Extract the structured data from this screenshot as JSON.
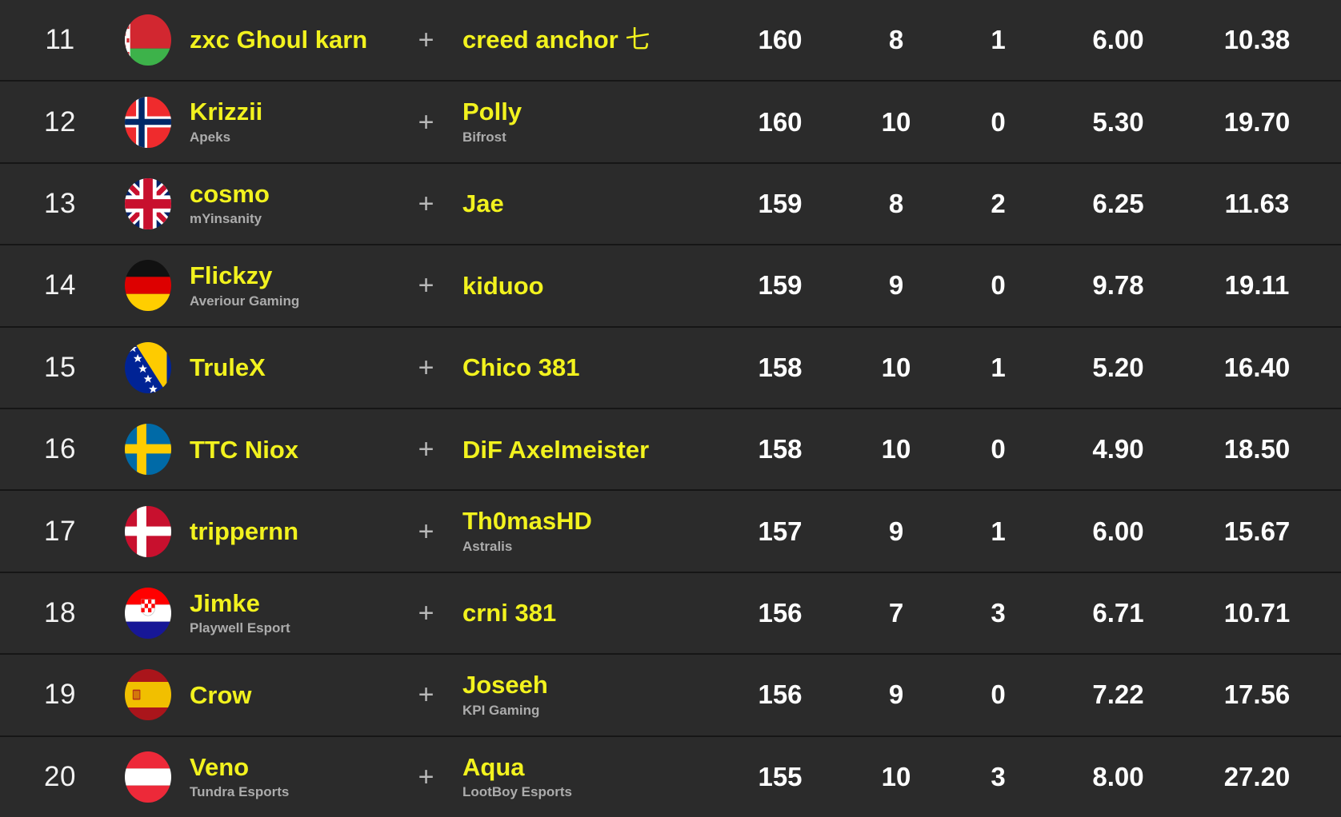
{
  "leaderboard": {
    "separator_symbol": "+",
    "colors": {
      "row_background": "#2b2b2b",
      "page_background": "#1c1c1c",
      "player_name": "#f2f21e",
      "team_name": "#acacac",
      "stat_value": "#ffffff",
      "rank": "#f2f2f2",
      "divider": "#161616"
    },
    "rows": [
      {
        "rank": "11",
        "flag": "belarus-flag",
        "player1": {
          "name": "zxc Ghoul karn",
          "team": ""
        },
        "player2": {
          "name": "creed anchor 七",
          "team": ""
        },
        "score": "160",
        "maps": "8",
        "extra": "1",
        "avg": "6.00",
        "last": "10.38"
      },
      {
        "rank": "12",
        "flag": "norway-flag",
        "player1": {
          "name": "Krizzii",
          "team": "Apeks"
        },
        "player2": {
          "name": "Polly",
          "team": "Bifrost"
        },
        "score": "160",
        "maps": "10",
        "extra": "0",
        "avg": "5.30",
        "last": "19.70"
      },
      {
        "rank": "13",
        "flag": "united-kingdom-flag",
        "player1": {
          "name": "cosmo",
          "team": "mYinsanity"
        },
        "player2": {
          "name": "Jae",
          "team": ""
        },
        "score": "159",
        "maps": "8",
        "extra": "2",
        "avg": "6.25",
        "last": "11.63"
      },
      {
        "rank": "14",
        "flag": "germany-flag",
        "player1": {
          "name": "Flickzy",
          "team": "Averiour Gaming"
        },
        "player2": {
          "name": "kiduoo",
          "team": ""
        },
        "score": "159",
        "maps": "9",
        "extra": "0",
        "avg": "9.78",
        "last": "19.11"
      },
      {
        "rank": "15",
        "flag": "bosnia-herzegovina-flag",
        "player1": {
          "name": "TruleX",
          "team": ""
        },
        "player2": {
          "name": "Chico 381",
          "team": ""
        },
        "score": "158",
        "maps": "10",
        "extra": "1",
        "avg": "5.20",
        "last": "16.40"
      },
      {
        "rank": "16",
        "flag": "sweden-flag",
        "player1": {
          "name": "TTC Niox",
          "team": ""
        },
        "player2": {
          "name": "DiF Axelmeister",
          "team": ""
        },
        "score": "158",
        "maps": "10",
        "extra": "0",
        "avg": "4.90",
        "last": "18.50"
      },
      {
        "rank": "17",
        "flag": "denmark-flag",
        "player1": {
          "name": "trippernn",
          "team": ""
        },
        "player2": {
          "name": "Th0masHD",
          "team": "Astralis"
        },
        "score": "157",
        "maps": "9",
        "extra": "1",
        "avg": "6.00",
        "last": "15.67"
      },
      {
        "rank": "18",
        "flag": "croatia-flag",
        "player1": {
          "name": "Jimke",
          "team": "Playwell Esport"
        },
        "player2": {
          "name": "crni 381",
          "team": ""
        },
        "score": "156",
        "maps": "7",
        "extra": "3",
        "avg": "6.71",
        "last": "10.71"
      },
      {
        "rank": "19",
        "flag": "spain-flag",
        "player1": {
          "name": "Crow",
          "team": ""
        },
        "player2": {
          "name": "Joseeh",
          "team": "KPI Gaming"
        },
        "score": "156",
        "maps": "9",
        "extra": "0",
        "avg": "7.22",
        "last": "17.56"
      },
      {
        "rank": "20",
        "flag": "austria-flag",
        "player1": {
          "name": "Veno",
          "team": "Tundra Esports"
        },
        "player2": {
          "name": "Aqua",
          "team": "LootBoy Esports"
        },
        "score": "155",
        "maps": "10",
        "extra": "3",
        "avg": "8.00",
        "last": "27.20"
      }
    ]
  }
}
